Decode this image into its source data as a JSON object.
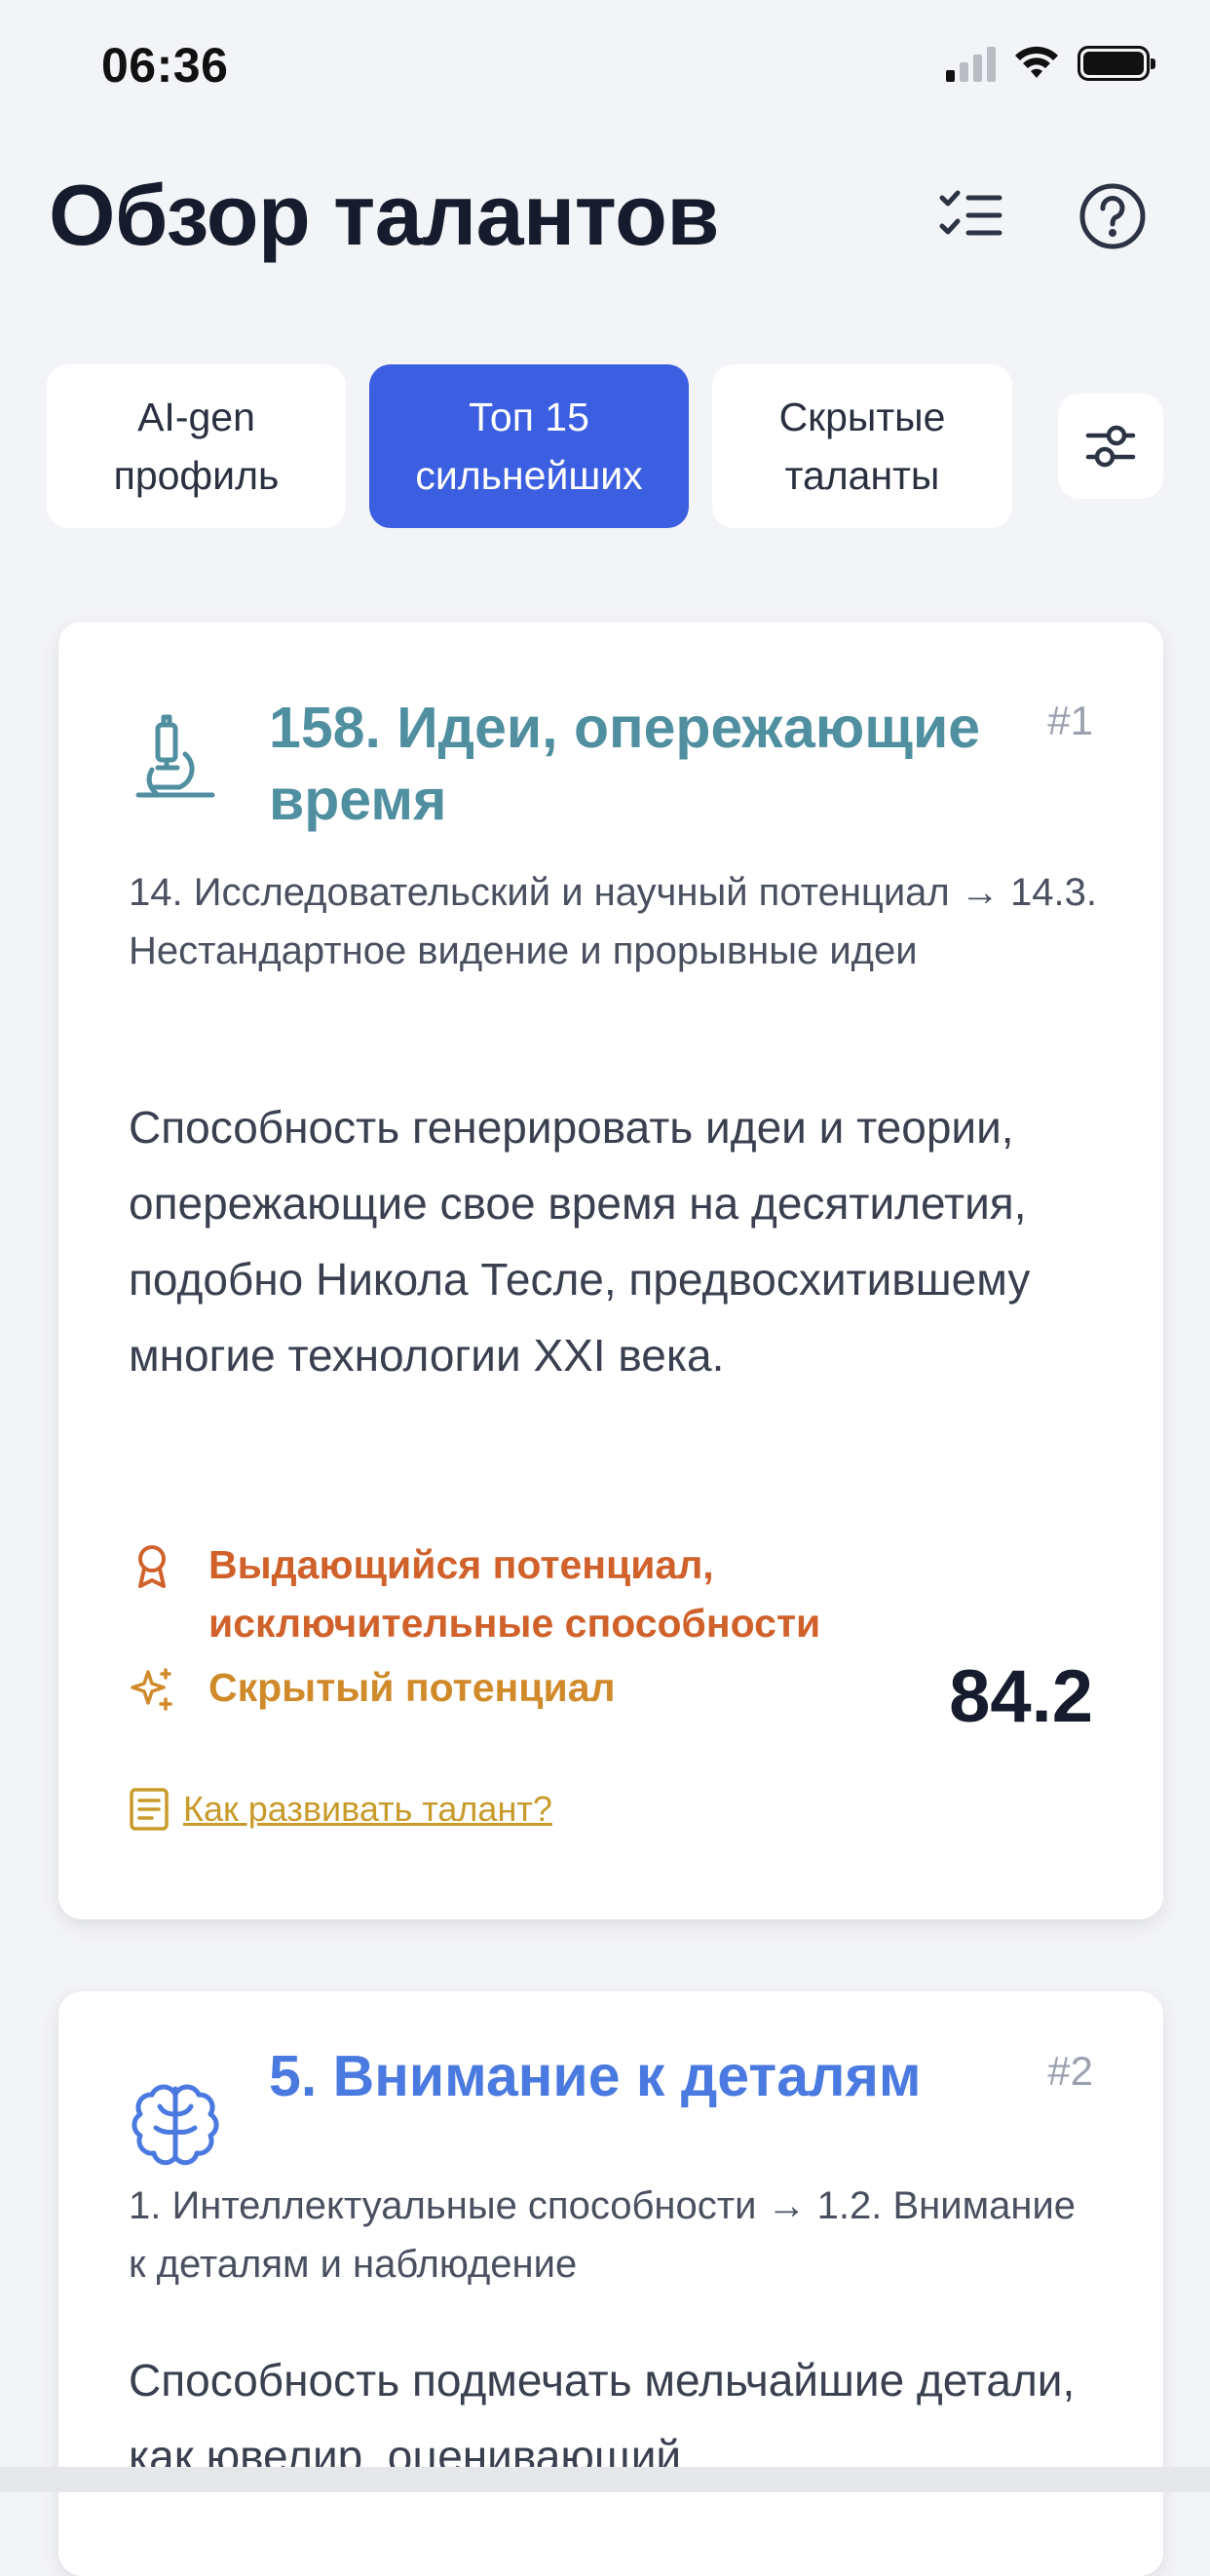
{
  "status": {
    "time": "06:36"
  },
  "header": {
    "title": "Обзор талантов"
  },
  "tabs": [
    {
      "label": "AI-gen\nпрофиль",
      "active": false
    },
    {
      "label": "Топ 15\nсильнейших",
      "active": true
    },
    {
      "label": "Скрытые\nталанты",
      "active": false
    }
  ],
  "colors": {
    "accent": "#3b5fe0",
    "card1_title": "#4f8fa0",
    "card2_title": "#4a7ae0",
    "level_outstanding": "#d0612a",
    "level_hidden": "#d08a2a",
    "link": "#c89a2a"
  },
  "cards": [
    {
      "icon": "microscope-icon",
      "title": "158. Идеи, опережающие время",
      "rank": "#1",
      "path": "14. Исследовательский и научный потенциал → 14.3. Нестандартное видение и прорывные идеи",
      "description": "Способность генерировать идеи и теории, опережающие свое время на десятилетия, подобно Никола Тесле, предвосхитившему многие технологии XXI века.",
      "level": "Выдающийся потенциал, исключительные способности",
      "hidden": "Скрытый потенциал",
      "score": "84.2",
      "link": "Как развивать талант?"
    },
    {
      "icon": "brain-icon",
      "title": "5. Внимание к деталям",
      "rank": "#2",
      "path": "1. Интеллектуальные способности → 1.2. Внимание к деталям и наблюдение",
      "description": "Способность подмечать мельчайшие детали, как ювелир, оценивающий"
    }
  ]
}
